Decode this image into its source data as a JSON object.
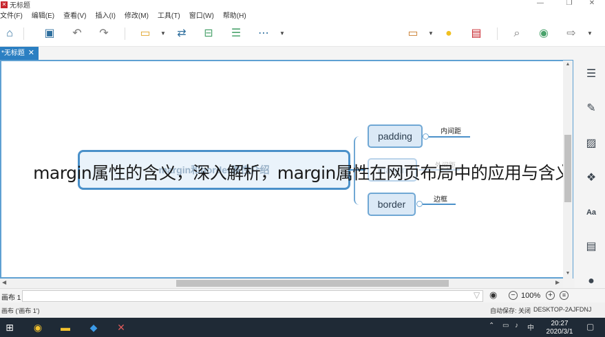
{
  "window": {
    "title": "无标题",
    "min": "—",
    "max": "❐",
    "close": "✕"
  },
  "menu": [
    "文件(F)",
    "编辑(E)",
    "查看(V)",
    "插入(I)",
    "修改(M)",
    "工具(T)",
    "窗口(W)",
    "帮助(H)"
  ],
  "toolbar": {
    "icons": [
      "home-icon",
      "save-icon",
      "undo-icon",
      "redo-icon",
      "topic-icon",
      "relationship-icon",
      "summary-icon",
      "boundary-icon",
      "more-icon",
      "presentation-icon",
      "idea-icon",
      "outline-icon",
      "search-icon",
      "share-icon",
      "export-icon"
    ]
  },
  "tab": {
    "label": "*无标题",
    "close": "✕"
  },
  "mindmap": {
    "central_topic": "margin和border属性介绍",
    "subtopics": [
      {
        "label": "padding",
        "note": "内间距"
      },
      {
        "label": "margin",
        "note": "外间距"
      },
      {
        "label": "border",
        "note": "边框"
      }
    ]
  },
  "caption": "margin属性的含义，深入解析，margin属性在网页布局中的应用与含义",
  "sheetbar": {
    "label": "画布 1",
    "zoom": "100%",
    "zoom_out": "−",
    "zoom_in": "+",
    "zoom_fit": "≡"
  },
  "status": {
    "left": "画布 ('画布 1')",
    "autosave": "自动保存: 关闭",
    "host": "DESKTOP-2AJFDNJ"
  },
  "taskbar": {
    "time": "20:27",
    "date": "2020/3/1",
    "tray_lang": "中"
  },
  "right_panel": {
    "icons": [
      "format-icon",
      "style-icon",
      "image-icon",
      "text-icon",
      "notes-icon",
      "comments-icon"
    ]
  },
  "colors": {
    "accent": "#2b7fc2",
    "topic_border": "#4a90c9",
    "taskbar": "#1f2a36"
  }
}
